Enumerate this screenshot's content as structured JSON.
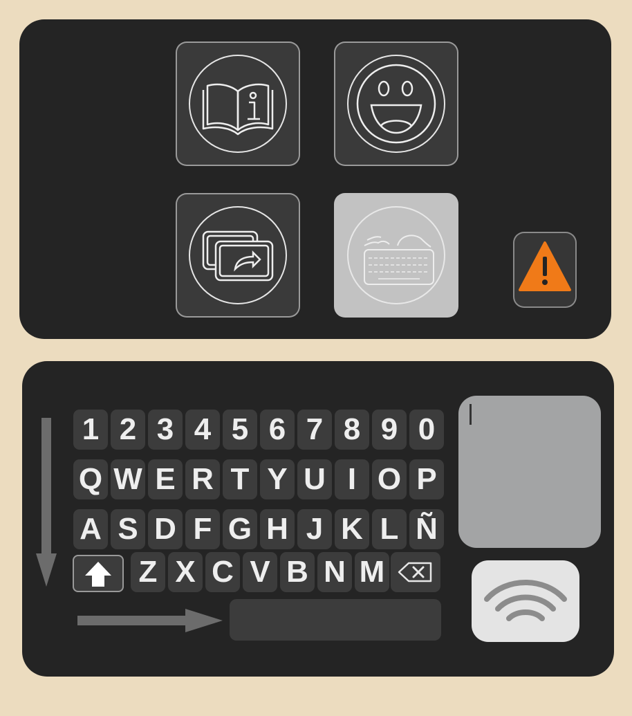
{
  "icons": {
    "manual": "book-info-icon",
    "emoji": "smiley-face-icon",
    "share": "screen-share-icon",
    "keyboard": "keyboard-icon",
    "alert": "warning-triangle-icon",
    "shift": "shift-arrow-icon",
    "backspace": "backspace-icon",
    "contactless": "contactless-waves-icon"
  },
  "keyboard": {
    "rows": [
      [
        "1",
        "2",
        "3",
        "4",
        "5",
        "6",
        "7",
        "8",
        "9",
        "0"
      ],
      [
        "Q",
        "W",
        "E",
        "R",
        "T",
        "Y",
        "U",
        "I",
        "O",
        "P"
      ],
      [
        "A",
        "S",
        "D",
        "F",
        "G",
        "H",
        "J",
        "K",
        "L",
        "Ñ"
      ],
      [
        "Z",
        "X",
        "C",
        "V",
        "B",
        "N",
        "M"
      ]
    ],
    "active_mode": "keyboard"
  },
  "text_display": {
    "value": ""
  },
  "colors": {
    "background": "#ecdcbf",
    "panel": "#242424",
    "key": "#3c3c3c",
    "alert": "#f07a18",
    "active_tile": "#c2c2c2"
  }
}
